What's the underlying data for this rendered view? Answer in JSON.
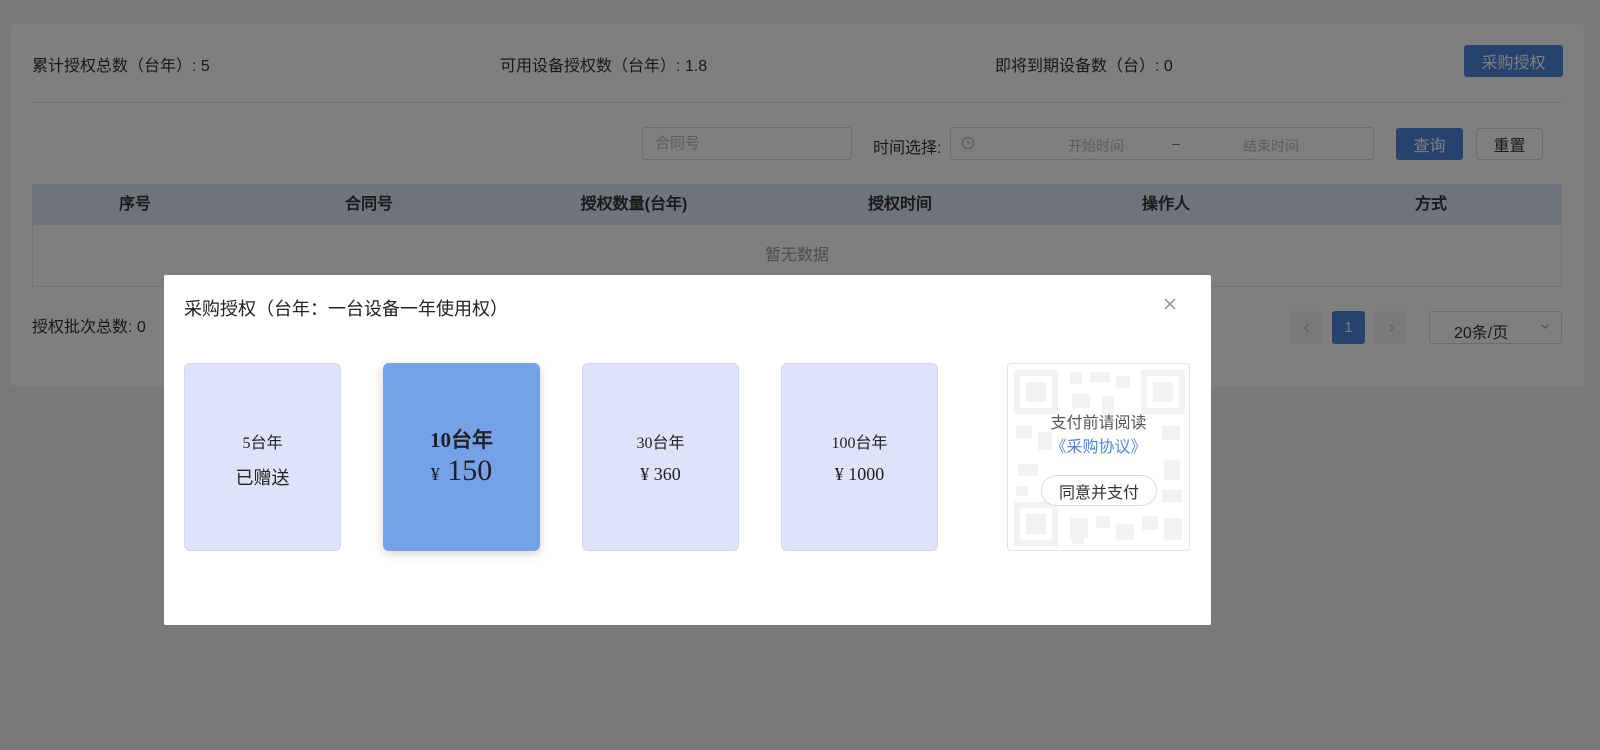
{
  "stats": {
    "total_auth": "累计授权总数（台年）: 5",
    "available_auth": "可用设备授权数（台年）: 1.8",
    "expiring": "即将到期设备数（台）: 0"
  },
  "buy_button": "采购授权",
  "filters": {
    "contract_placeholder": "合同号",
    "time_label": "时间选择:",
    "start_placeholder": "开始时间",
    "range_separator": "–",
    "end_placeholder": "结束时间",
    "query_button": "查询",
    "reset_button": "重置"
  },
  "table": {
    "columns": [
      "序号",
      "合同号",
      "授权数量(台年)",
      "授权时间",
      "操作人",
      "方式"
    ],
    "empty_text": "暂无数据"
  },
  "footer": {
    "total_batches": "授权批次总数: 0",
    "current_page": "1",
    "page_size": "20条/页"
  },
  "modal": {
    "title": "采购授权（台年：一台设备一年使用权）",
    "packages": [
      {
        "count": "5台年",
        "price": "已赠送",
        "selected": false
      },
      {
        "count": "10台年",
        "price": "150",
        "currency": "¥",
        "selected": true
      },
      {
        "count": "30台年",
        "price": "360",
        "currency": "¥",
        "selected": false
      },
      {
        "count": "100台年",
        "price": "1000",
        "currency": "¥",
        "selected": false
      }
    ],
    "pay": {
      "notice": "支付前请阅读",
      "agreement_link": "《采购协议》",
      "button": "同意并支付"
    }
  },
  "colors": {
    "primary": "#4d86e0",
    "package_bg": "#dfe3f9",
    "package_selected_bg": "#75a1e8",
    "table_header_bg": "#dfe6f7"
  },
  "icons": [
    "clock-icon",
    "chevron-left-icon",
    "chevron-right-icon",
    "chevron-down-icon",
    "close-icon",
    "qr-code-icon"
  ]
}
